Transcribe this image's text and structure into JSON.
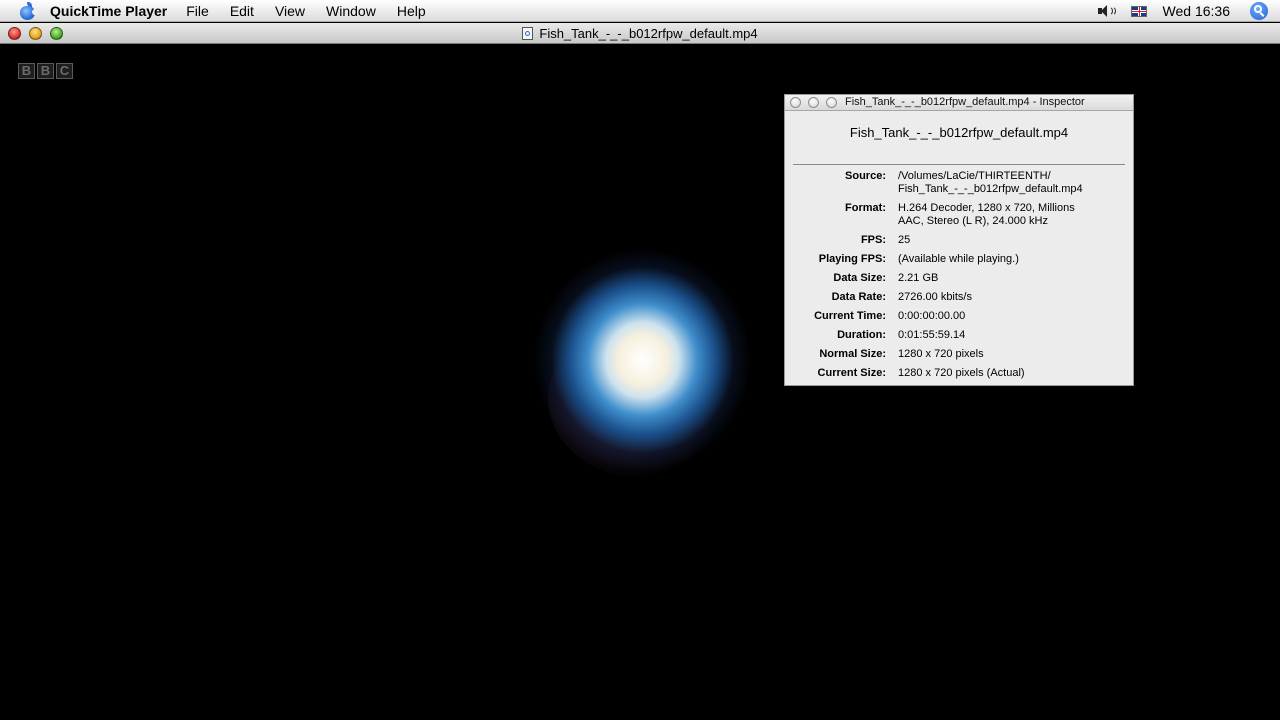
{
  "menubar": {
    "app_name": "QuickTime Player",
    "items": [
      "File",
      "Edit",
      "View",
      "Window",
      "Help"
    ],
    "clock": "Wed 16:36"
  },
  "window": {
    "title": "Fish_Tank_-_-_b012rfpw_default.mp4"
  },
  "video": {
    "watermark_letters": [
      "B",
      "B",
      "C"
    ]
  },
  "inspector": {
    "title": "Fish_Tank_-_-_b012rfpw_default.mp4 - Inspector",
    "file_name": "Fish_Tank_-_-_b012rfpw_default.mp4",
    "rows": [
      {
        "label": "Source:",
        "lines": [
          "/Volumes/LaCie/THIRTEENTH/",
          "Fish_Tank_-_-_b012rfpw_default.mp4"
        ]
      },
      {
        "label": "Format:",
        "lines": [
          "H.264 Decoder, 1280 x 720, Millions",
          "AAC, Stereo (L R), 24.000 kHz"
        ]
      },
      {
        "label": "FPS:",
        "lines": [
          "25"
        ]
      },
      {
        "label": "Playing FPS:",
        "lines": [
          "(Available while playing.)"
        ]
      },
      {
        "label": "Data Size:",
        "lines": [
          "2.21 GB"
        ]
      },
      {
        "label": "Data Rate:",
        "lines": [
          "2726.00 kbits/s"
        ]
      },
      {
        "label": "Current Time:",
        "lines": [
          "0:00:00:00.00"
        ]
      },
      {
        "label": "Duration:",
        "lines": [
          "0:01:55:59.14"
        ]
      },
      {
        "label": "Normal Size:",
        "lines": [
          "1280 x 720 pixels"
        ]
      },
      {
        "label": "Current Size:",
        "lines": [
          "1280 x 720 pixels (Actual)"
        ]
      }
    ]
  }
}
